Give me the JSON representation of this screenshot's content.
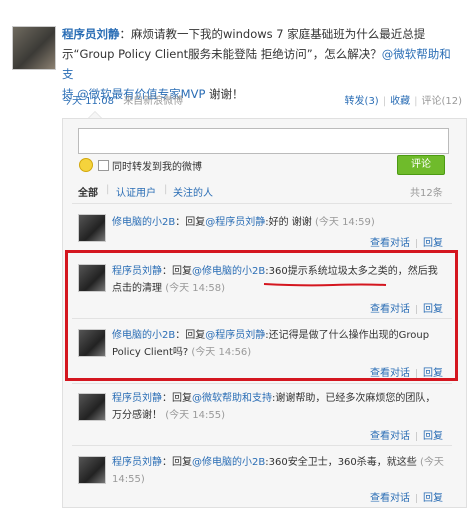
{
  "post": {
    "author": "程序员刘静",
    "line1": "：麻烦请教一下我的windows 7 家庭基础班为什么最近总提",
    "line2": "示“Group Policy Client服务未能登陆 拒绝访问”，怎么解决？",
    "mention1": "@微软帮助和支",
    "line3a": "持",
    "mention2": "@微软最有价值专家MVP",
    "line3b": "谢谢！",
    "time": "今天 11:08",
    "source": "来自新浪微博",
    "repost": "转发(3)",
    "favorite": "收藏",
    "comment": "评论(12)"
  },
  "composer": {
    "input_value": "",
    "also_repost": "同时转发到我的微博",
    "submit": "评论"
  },
  "filters": {
    "all": "全部",
    "verified": "认证用户",
    "following": "关注的人",
    "count": "共12条"
  },
  "comments": [
    {
      "user": "修电脑的小2B",
      "reply_word": "：回复",
      "reply_to": "@程序员刘静",
      "body": ":好的 谢谢",
      "time": "(今天 14:59)",
      "line2": "",
      "view": "查看对话",
      "reply": "回复"
    },
    {
      "user": "程序员刘静",
      "reply_word": "：回复",
      "reply_to": "@修电脑的小2B",
      "body": ":360提示系统垃圾太多之类的，然后我",
      "line2": "点击的清理",
      "time": "(今天 14:58)",
      "view": "查看对话",
      "reply": "回复"
    },
    {
      "user": "修电脑的小2B",
      "reply_word": "：回复",
      "reply_to": "@程序员刘静",
      "body": ":还记得是做了什么操作出现的Group",
      "line2": "Policy Client吗?",
      "time": "(今天 14:56)",
      "view": "查看对话",
      "reply": "回复"
    },
    {
      "user": "程序员刘静",
      "reply_word": "：回复",
      "reply_to": "@微软帮助和支持",
      "body": ":谢谢帮助，已经多次麻烦您的团队，",
      "line2": "万分感谢！",
      "time": "(今天 14:55)",
      "view": "查看对话",
      "reply": "回复"
    },
    {
      "user": "程序员刘静",
      "reply_word": "：回复",
      "reply_to": "@修电脑的小2B",
      "body": ":360安全卫士，360杀毒，就这些",
      "line2": "14:55)",
      "time": "(今天",
      "view": "查看对话",
      "reply": "回复"
    }
  ],
  "colors": {
    "link": "#2a6db5",
    "highlight": "#d4161f",
    "button": "#6fbb2b"
  }
}
